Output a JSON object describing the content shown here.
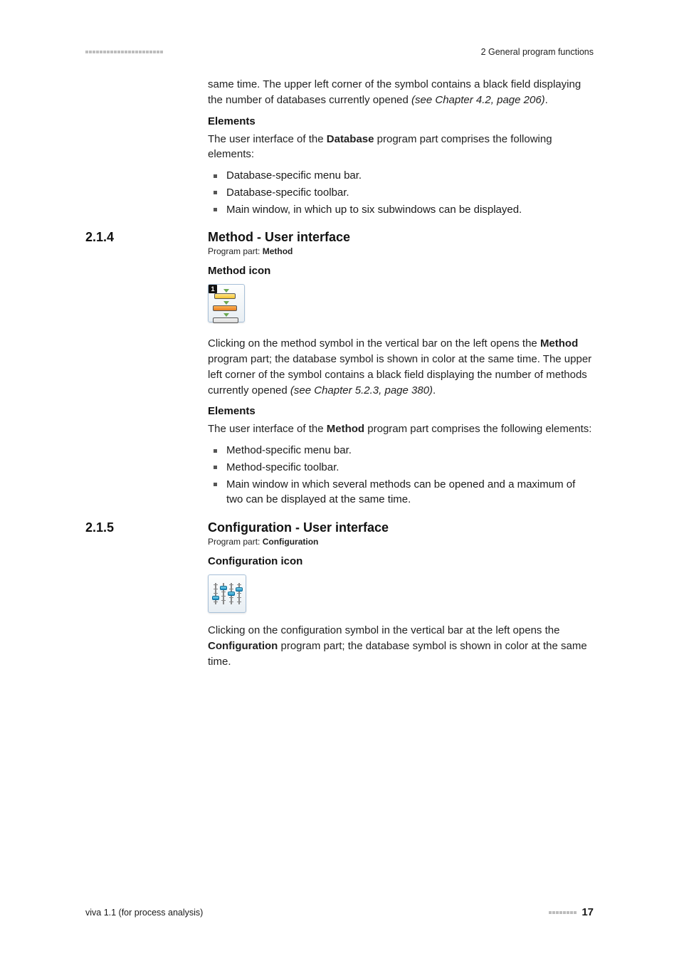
{
  "header": {
    "breadcrumb": "2 General program functions"
  },
  "intro_paragraph": {
    "pre": "same time. The upper left corner of the symbol contains a black field displaying the number of databases currently opened ",
    "italic": "(see Chapter 4.2, page 206)",
    "post": "."
  },
  "db_elements": {
    "heading": "Elements",
    "intro_pre": "The user interface of the ",
    "intro_bold": "Database",
    "intro_post": " program part comprises the following elements:",
    "items": [
      "Database-specific menu bar.",
      "Database-specific toolbar.",
      "Main window, in which up to six subwindows can be displayed."
    ]
  },
  "section_214": {
    "num": "2.1.4",
    "title": "Method - User interface",
    "pp_label": "Program part: ",
    "pp_value": "Method",
    "icon_heading": "Method icon",
    "icon_badge": "1",
    "para": {
      "pre": "Clicking on the method symbol in the vertical bar on the left opens the ",
      "bold": "Method",
      "mid": " program part; the database symbol is shown in color at the same time. The upper left corner of the symbol contains a black field displaying the number of methods currently opened ",
      "italic": "(see Chapter 5.2.3, page 380)",
      "post": "."
    },
    "elements": {
      "heading": "Elements",
      "intro_pre": "The user interface of the ",
      "intro_bold": "Method",
      "intro_post": " program part comprises the following elements:",
      "items": [
        "Method-specific menu bar.",
        "Method-specific toolbar.",
        "Main window in which several methods can be opened and a maximum of two can be displayed at the same time."
      ]
    }
  },
  "section_215": {
    "num": "2.1.5",
    "title": "Configuration - User interface",
    "pp_label": "Program part: ",
    "pp_value": "Configuration",
    "icon_heading": "Configuration icon",
    "para": {
      "pre": "Clicking on the configuration symbol in the vertical bar at the left opens the ",
      "bold": "Configuration",
      "mid": " program part; the database symbol is shown in color at the same time.",
      "post": ""
    }
  },
  "footer": {
    "left": "viva 1.1 (for process analysis)",
    "page": "17"
  }
}
